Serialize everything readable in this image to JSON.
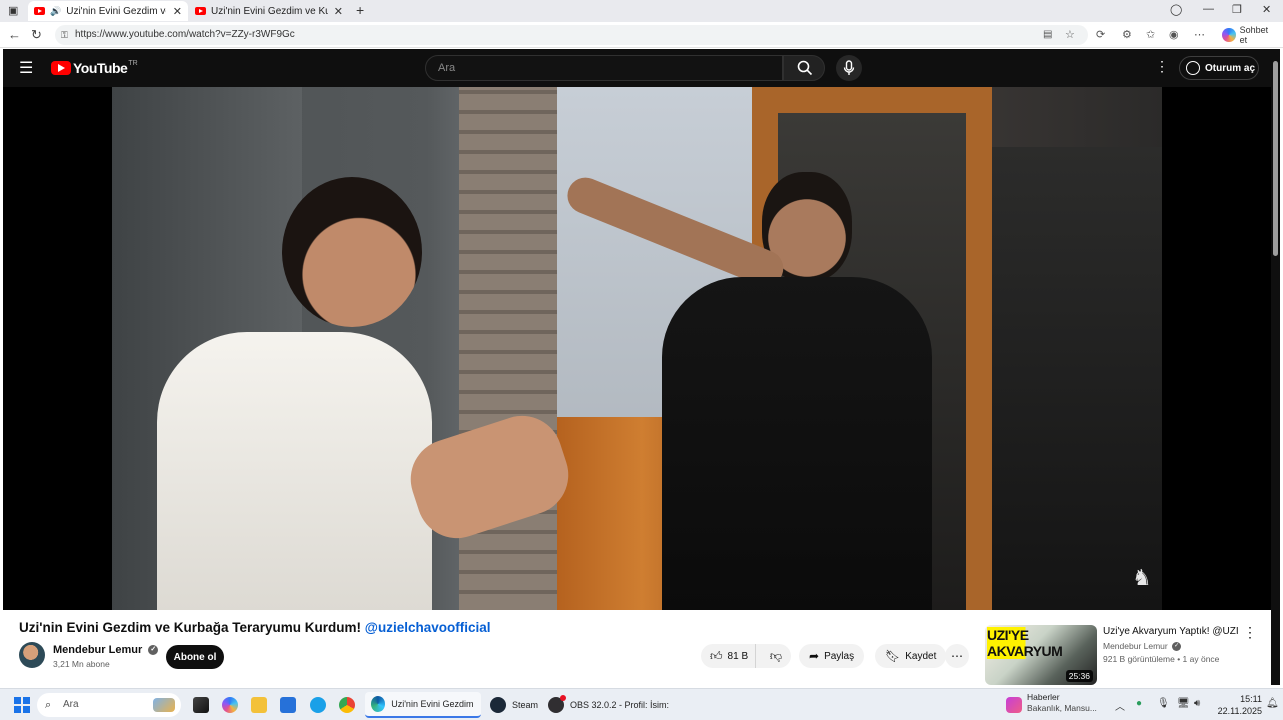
{
  "browser": {
    "tabs": [
      {
        "title": "Uzi'nin Evini Gezdim ve Kurbağa Teraryumu Kurdum!",
        "active": true,
        "audio": true
      },
      {
        "title": "Uzi'nin Evini Gezdim ve Kurbağa Teraryumu Kurdum!",
        "active": false,
        "audio": false
      }
    ],
    "new_tab": "+",
    "url": "https://www.youtube.com/watch?v=ZZy-r3WF9Gc",
    "chat_label": "Sohbet et"
  },
  "youtube": {
    "logo_text": "YouTube",
    "country_code": "TR",
    "search_placeholder": "Ara",
    "signin_label": "Oturum aç",
    "video": {
      "title": "Uzi'nin Evini Gezdim ve Kurbağa Teraryumu Kurdum!",
      "mention": "@uzielchavoofficial",
      "channel": "Mendebur Lemur",
      "subscribers": "3,21 Mn abone",
      "subscribe_label": "Abone ol",
      "likes": "81 B",
      "share_label": "Paylaş",
      "save_label": "Kaydet"
    },
    "recommendation": {
      "title": "Uzi'ye Akvaryum Yaptık! @UZI",
      "channel": "Mendebur Lemur",
      "views": "921 B görüntüleme",
      "age": "1 ay önce",
      "duration": "25:36",
      "thumb_text": "UZI'YE AKVARYUM"
    }
  },
  "taskbar": {
    "search_placeholder": "Ara",
    "apps": [
      {
        "label": "Uzi'nin Evini Gezdim ve"
      },
      {
        "label": "Steam"
      },
      {
        "label": "OBS 32.0.2 - Profil: İsim:"
      }
    ],
    "news_title": "Haberler",
    "news_sub": "Bakanlık, Mansu...",
    "time": "15:11",
    "date": "22.11.2025"
  }
}
